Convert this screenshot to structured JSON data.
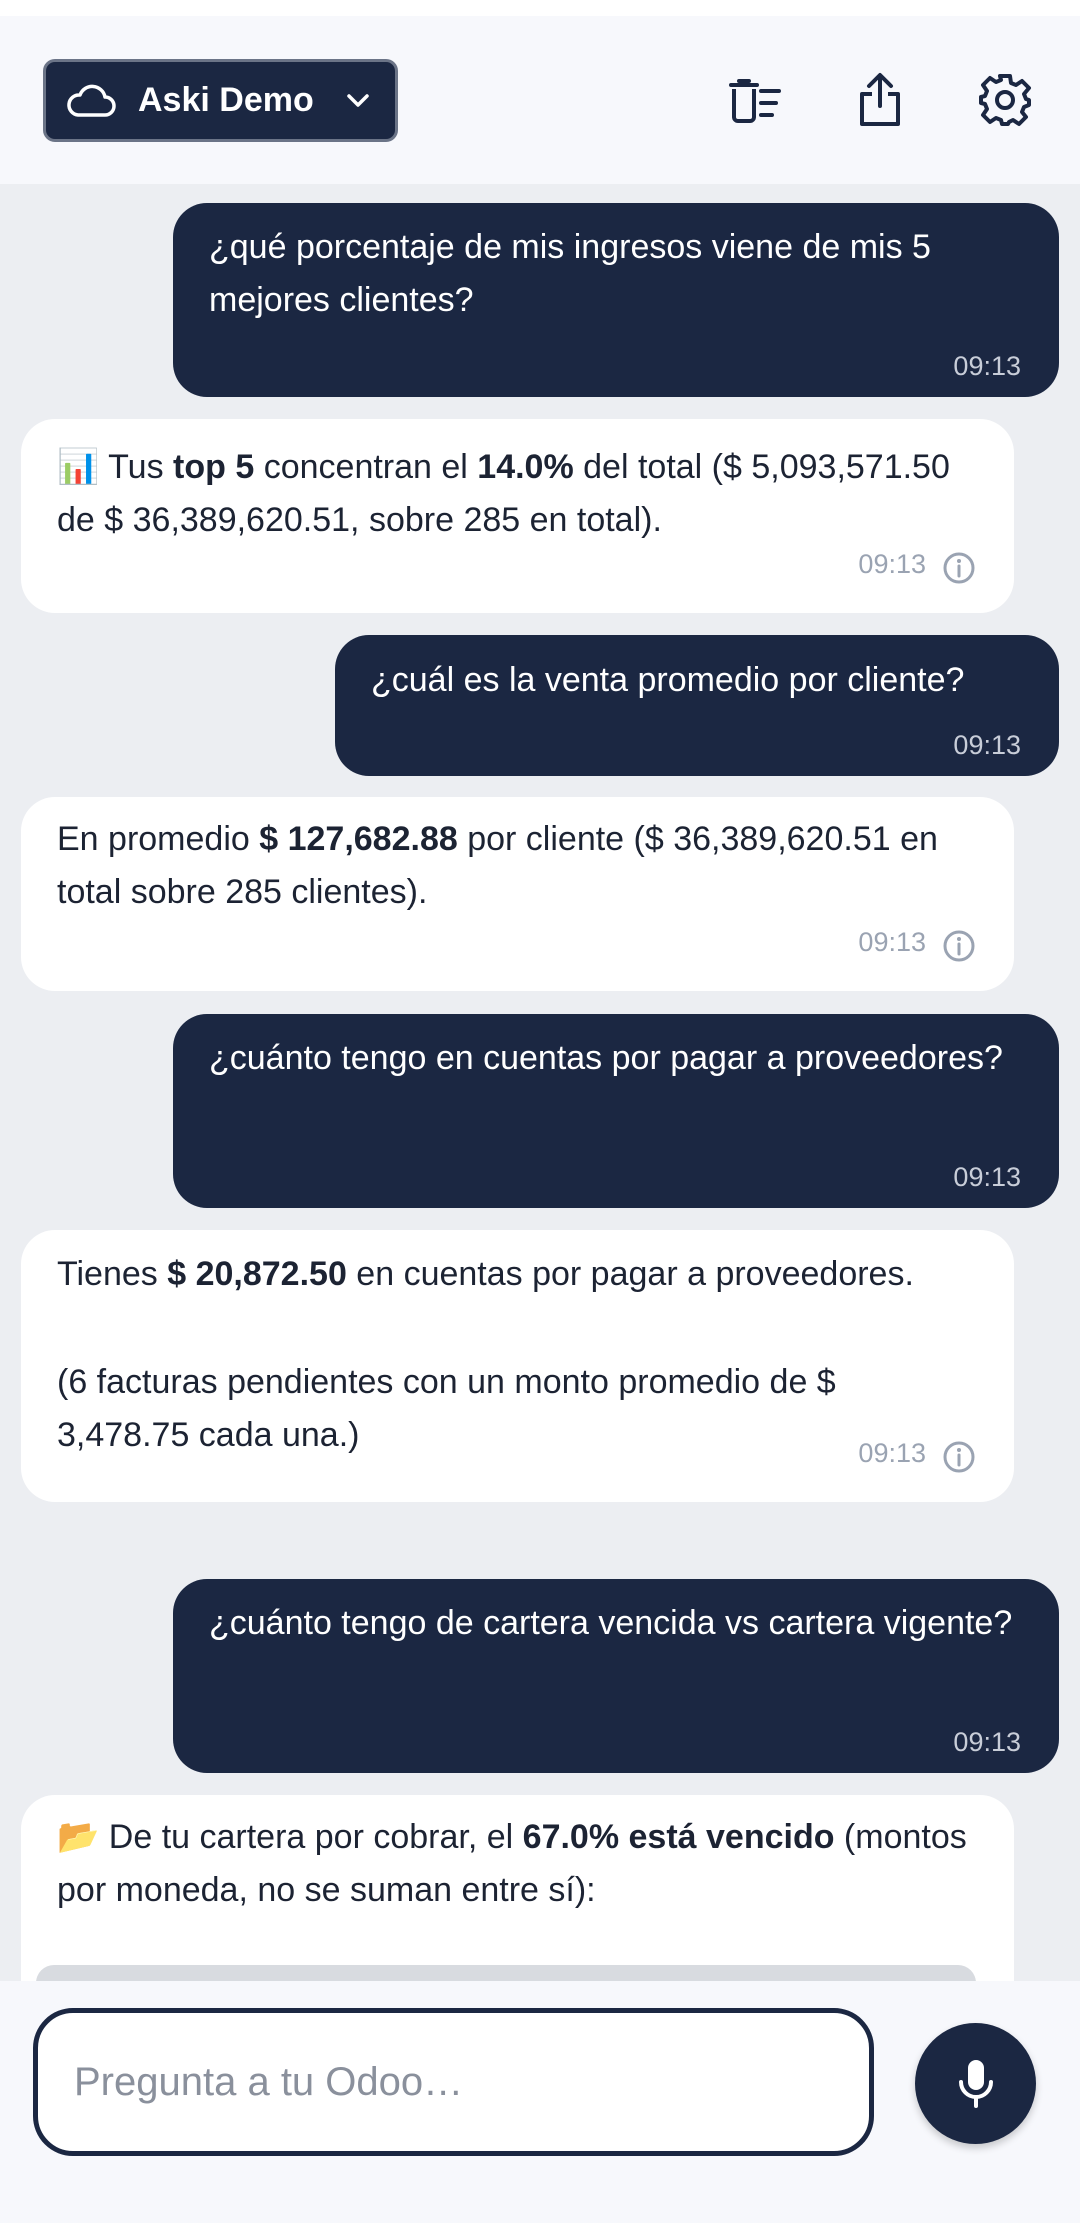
{
  "header": {
    "account_label": "Aski Demo",
    "icons": [
      "cloud-icon",
      "chevron-down-icon",
      "clear-chat-icon",
      "share-icon",
      "gear-icon"
    ]
  },
  "messages": [
    {
      "role": "user",
      "text": "¿qué porcentaje de mis ingresos viene de mis 5 mejores clientes?",
      "time": "09:13"
    },
    {
      "role": "bot",
      "time": "09:13",
      "parts": {
        "emoji": "📊",
        "a": " Tus ",
        "b1": "top 5",
        "c": " concentran el ",
        "b2": "14.0%",
        "d": " del total ($ 5,093,571.50 de $ 36,389,620.51, sobre 285 en total)."
      }
    },
    {
      "role": "user",
      "text": "¿cuál es la venta promedio por cliente?",
      "time": "09:13"
    },
    {
      "role": "bot",
      "time": "09:13",
      "parts": {
        "a": "En promedio ",
        "b1": "$ 127,682.88",
        "c": " por cliente ($ 36,389,620.51 en total sobre 285 clientes)."
      }
    },
    {
      "role": "user",
      "text": "¿cuánto tengo en cuentas por pagar a proveedores?",
      "time": "09:13"
    },
    {
      "role": "bot",
      "time": "09:13",
      "parts": {
        "a": "Tienes ",
        "b1": "$ 20,872.50",
        "c": " en cuentas por pagar a proveedores.",
        "p2": "(6 facturas pendientes con un monto promedio de $ 3,478.75 cada una.)"
      }
    },
    {
      "role": "user",
      "text": "¿cuánto tengo de cartera vencida vs cartera vigente?",
      "time": "09:13"
    },
    {
      "role": "bot",
      "parts": {
        "emoji": "📂",
        "a": " De tu cartera por cobrar, el ",
        "b1": "67.0% está vencido",
        "c": " (montos por moneda, no se suman entre sí):"
      }
    }
  ],
  "composer": {
    "placeholder": "Pregunta a tu Odoo…",
    "value": ""
  }
}
